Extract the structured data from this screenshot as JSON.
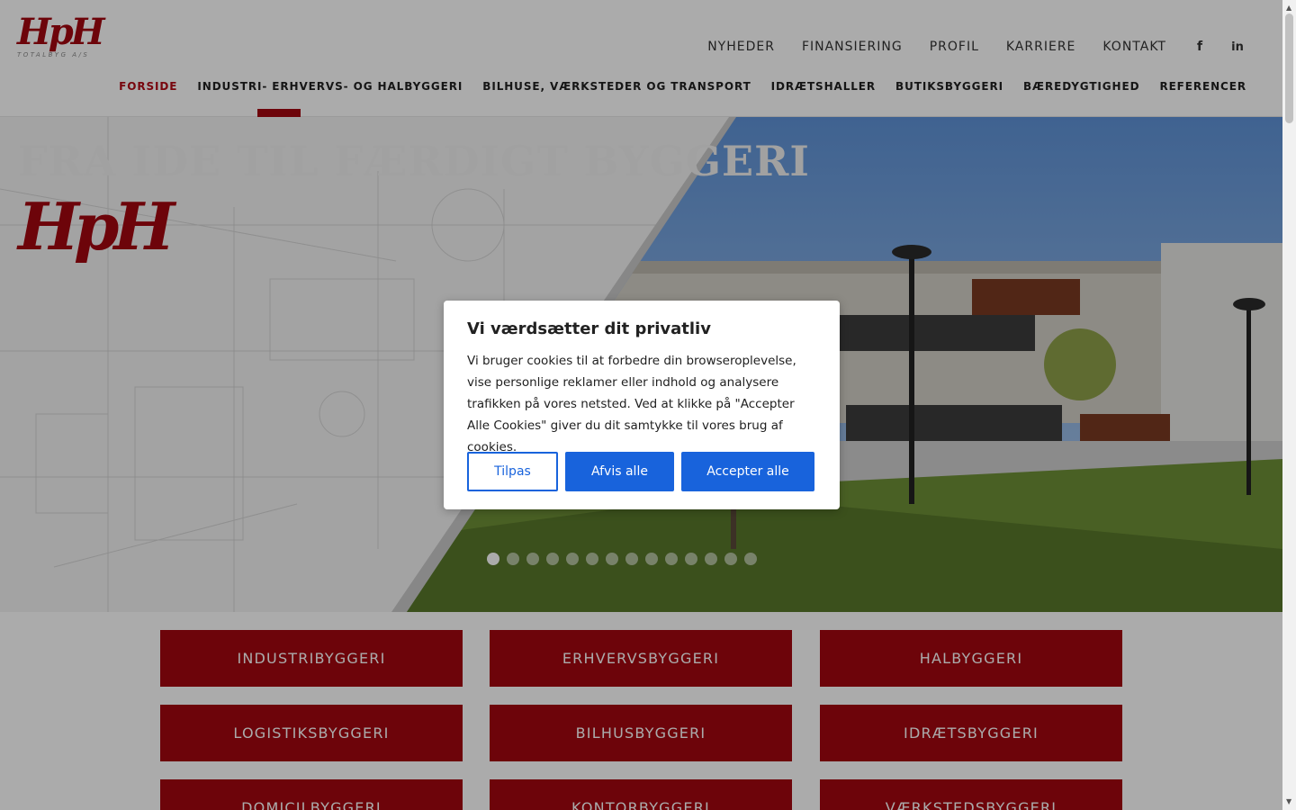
{
  "brand": {
    "logo_text": "HpH",
    "logo_sub": "TOTALBYG A/S",
    "accent_color": "#a3060f"
  },
  "topnav": {
    "items": [
      "NYHEDER",
      "FINANSIERING",
      "PROFIL",
      "KARRIERE",
      "KONTAKT"
    ],
    "social": [
      {
        "icon": "facebook-icon",
        "glyph": "f"
      },
      {
        "icon": "linkedin-icon",
        "glyph": "in"
      }
    ]
  },
  "mainnav": {
    "items": [
      "FORSIDE",
      "INDUSTRI- ERHVERVS- OG HALBYGGERI",
      "BILHUSE, VÆRKSTEDER OG TRANSPORT",
      "IDRÆTSHALLER",
      "BUTIKSBYGGERI",
      "BÆREDYGTIGHED",
      "REFERENCER"
    ],
    "active_index": 0
  },
  "hero": {
    "title": "FRA IDE TIL FÆRDIGT BYGGERI",
    "logo_text": "HpH",
    "slide_count": 14,
    "active_slide": 1
  },
  "categories": [
    "INDUSTRIBYGGERI",
    "ERHVERVSBYGGERI",
    "HALBYGGERI",
    "LOGISTIKSBYGGERI",
    "BILHUSBYGGERI",
    "IDRÆTSBYGGERI",
    "DOMICILBYGGERI",
    "KONTORBYGGERI",
    "VÆRKSTEDSBYGGERI"
  ],
  "cookie_dialog": {
    "title": "Vi værdsætter dit privatliv",
    "body": "Vi bruger cookies til at forbedre din browseroplevelse, vise personlige reklamer eller indhold og analysere trafikken på vores netsted. Ved at klikke på \"Accepter Alle Cookies\" giver du dit samtykke til vores brug af cookies.",
    "customize_label": "Tilpas",
    "reject_label": "Afvis alle",
    "accept_label": "Accepter alle",
    "button_color": "#1863dc"
  }
}
